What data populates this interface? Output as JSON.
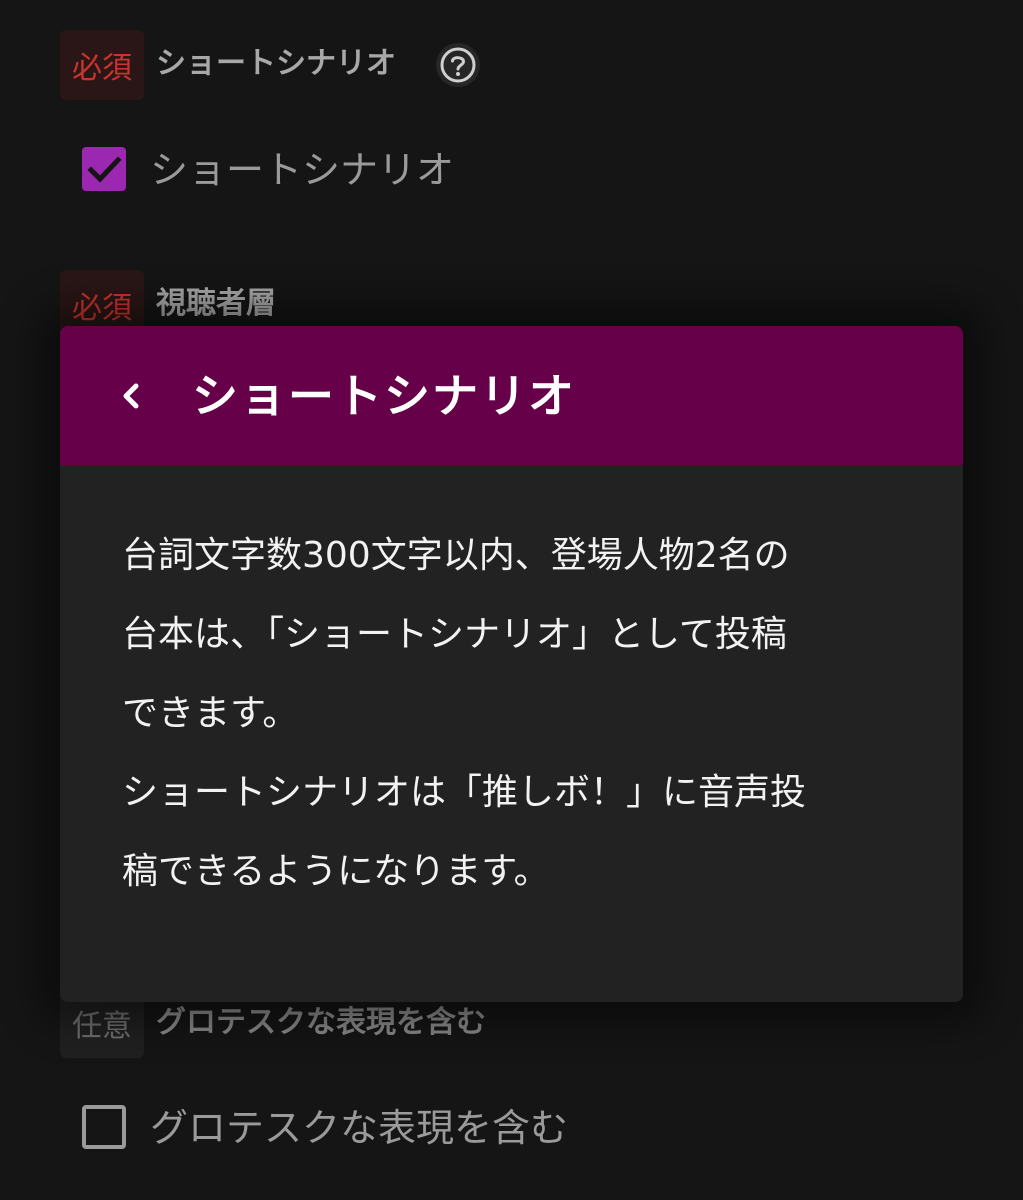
{
  "form": {
    "fields": [
      {
        "badge": "必須",
        "label": "ショートシナリオ",
        "checkbox_label": "ショートシナリオ",
        "checked": true
      },
      {
        "badge": "必須",
        "label": "視聴者層"
      },
      {
        "badge": "任意",
        "label": "グロテスクな表現を含む",
        "checkbox_label": "グロテスクな表現を含む",
        "checked": false
      }
    ],
    "help_icon": "question-circle-icon"
  },
  "modal": {
    "title": "ショートシナリオ",
    "back_icon": "chevron-left-icon",
    "body_lines": [
      "台詞文字数300文字以内、登場人物2名の",
      "台本は、「ショートシナリオ」として投稿",
      "できます。",
      "ショートシナリオは「推しボ！」に音声投",
      "稿できるようになります。"
    ]
  },
  "colors": {
    "background": "#151515",
    "modal_header": "#660049",
    "modal_body": "#222222",
    "required_text": "#c9352d",
    "checkbox_checked": "#9c27b0"
  }
}
